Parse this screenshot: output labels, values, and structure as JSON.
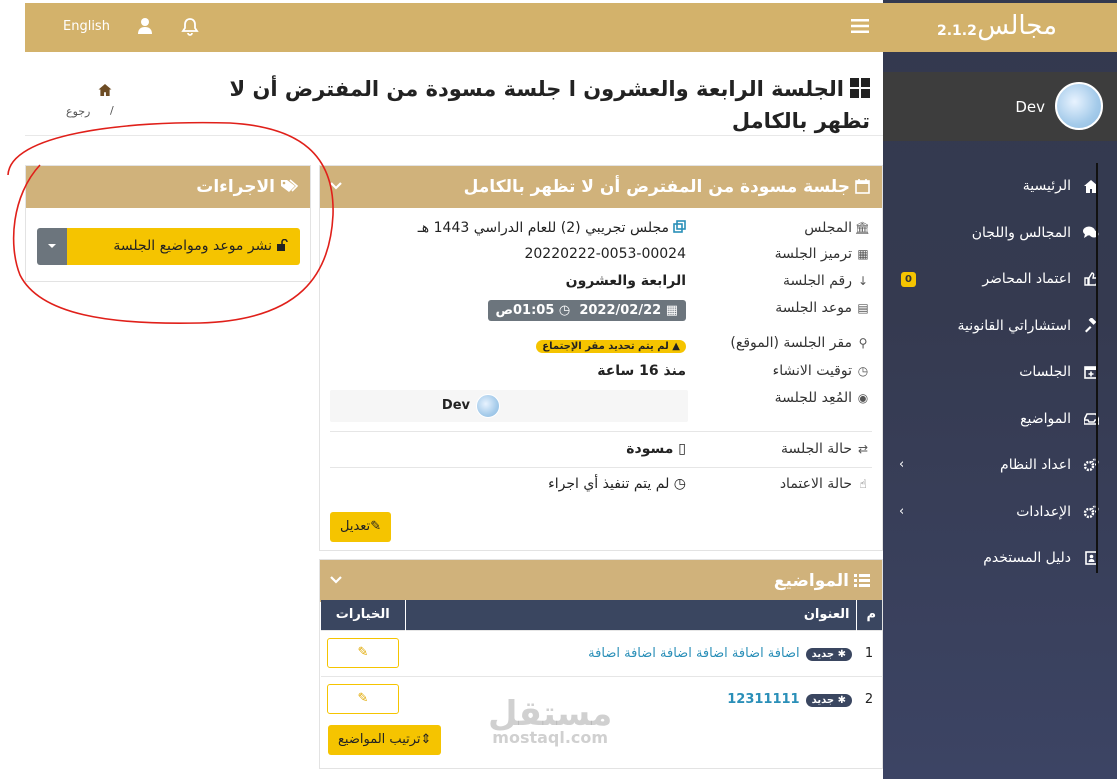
{
  "header": {
    "language": "English",
    "menu_icon": "bars-icon",
    "user_icon": "user-icon",
    "bell_icon": "bell-icon"
  },
  "brand": {
    "name": "مجالس",
    "version": "2.1.2"
  },
  "user": {
    "name": "Dev"
  },
  "sidebar": {
    "items": [
      {
        "label": "الرئيسية",
        "icon": "home-icon"
      },
      {
        "label": "المجالس واللجان",
        "icon": "comments-icon"
      },
      {
        "label": "اعتماد المحاضر",
        "icon": "thumbs-up-icon",
        "badge": "0"
      },
      {
        "label": "استشاراتي القانونية",
        "icon": "gavel-icon"
      },
      {
        "label": "الجلسات",
        "icon": "calendar-plus-icon"
      },
      {
        "label": "المواضيع",
        "icon": "inbox-icon"
      },
      {
        "label": "اعداد النظام",
        "icon": "cogs-icon",
        "chevron": "‹"
      },
      {
        "label": "الإعدادات",
        "icon": "cogs-icon",
        "chevron": "‹"
      },
      {
        "label": "دليل المستخدم",
        "icon": "address-book-icon"
      }
    ]
  },
  "page": {
    "title": "الجلسة الرابعة والعشرون ا جلسة مسودة من المفترض أن لا تظهر بالكامل",
    "breadcrumb_back": "رجوع",
    "breadcrumb_sep": "/"
  },
  "session_panel": {
    "title": "جلسة مسودة من المفترض أن لا تظهر بالكامل",
    "rows": {
      "council_label": "المجلس",
      "council_value": "مجلس تجريبي (2) للعام الدراسي 1443 هـ",
      "code_label": "ترميز الجلسة",
      "code_value": "20220222-0053-00024",
      "number_label": "رقم الجلسة",
      "number_value": "الرابعة والعشرون",
      "date_label": "موعد الجلسة",
      "date_value": "2022/02/22",
      "time_value": "01:05ص",
      "location_label": "مقر الجلسة (الموقع)",
      "location_warning": "لم يتم تحديد مقر الإجتماع",
      "created_label": "توقيت الانشاء",
      "created_value": "منذ 16 ساعة",
      "creator_label": "المُعِد للجلسة",
      "creator_value": "Dev",
      "status_label": "حالة الجلسة",
      "status_value": "مسودة",
      "approval_label": "حالة الاعتماد",
      "approval_value": "لم يتم تنفيذ أي اجراء"
    },
    "edit_label": "تعديل"
  },
  "actions_panel": {
    "title": "الاجراءات",
    "publish_label": "نشر موعد ومواضيع الجلسة"
  },
  "topics_panel": {
    "title": "المواضيع",
    "columns": {
      "num": "م",
      "title": "العنوان",
      "options": "الخيارات"
    },
    "new_tag": "جديد",
    "rows": [
      {
        "num": "1",
        "title": "اضافة اضافة اضافة اضافة اضافة اضافة"
      },
      {
        "num": "2",
        "title": "12311111"
      }
    ],
    "sort_label": "ترتيب المواضيع"
  },
  "watermark": {
    "arabic": "مستقل",
    "latin": "mostaql.com"
  },
  "colors": {
    "gold": "#d3b26b",
    "yellow": "#f5c400",
    "navy": "#3a4660",
    "link": "#2a8fb8"
  }
}
